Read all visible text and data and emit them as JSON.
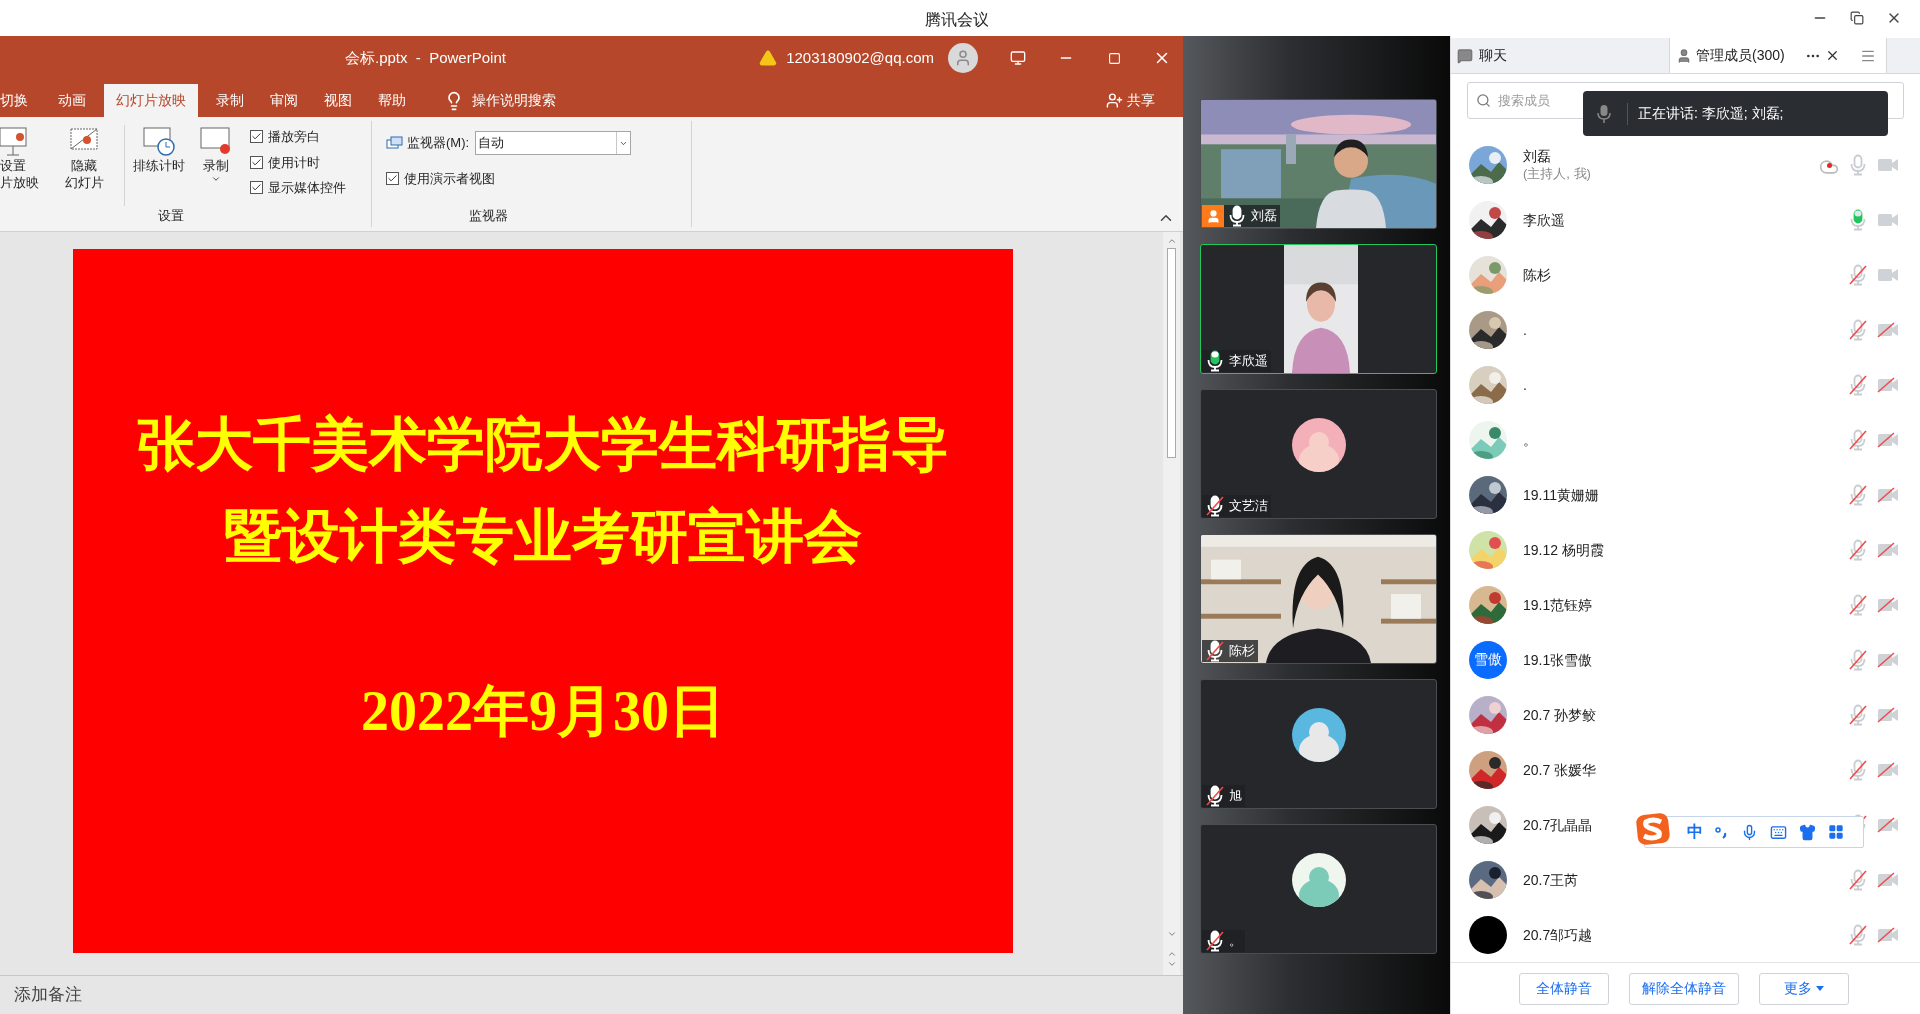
{
  "meeting": {
    "title": "腾讯会议"
  },
  "ppt": {
    "title": "会标.pptx  -  PowerPoint",
    "account": "1203180902@qq.com",
    "tabs": [
      {
        "label": "切换",
        "selected": false
      },
      {
        "label": "动画",
        "selected": false
      },
      {
        "label": "幻灯片放映",
        "selected": true
      },
      {
        "label": "录制",
        "selected": false
      },
      {
        "label": "审阅",
        "selected": false
      },
      {
        "label": "视图",
        "selected": false
      },
      {
        "label": "帮助",
        "selected": false
      }
    ],
    "search": "操作说明搜索",
    "share": "共享",
    "ribbon": {
      "commands": [
        {
          "kind": "setup",
          "lines": [
            "设置",
            "片放映"
          ]
        },
        {
          "kind": "hide",
          "lines": [
            "隐藏",
            "幻灯片"
          ]
        },
        {
          "kind": "rehearse",
          "lines": [
            "排练计时"
          ]
        },
        {
          "kind": "record",
          "lines": [
            "录制"
          ]
        }
      ],
      "options": [
        {
          "label": "播放旁白",
          "checked": true
        },
        {
          "label": "使用计时",
          "checked": true
        },
        {
          "label": "显示媒体控件",
          "checked": true
        }
      ],
      "monitor": {
        "label": "监视器(M):",
        "value": "自动"
      },
      "presenter_view": {
        "label": "使用演示者视图",
        "checked": true
      },
      "groups": [
        "设置",
        "监视器"
      ]
    },
    "slide": {
      "title_lines": [
        "张大千美术学院大学生科研指导",
        "暨设计类专业考研宣讲会"
      ],
      "date": "2022年9月30日"
    },
    "notes": "添加备注"
  },
  "videos": [
    {
      "name": "刘磊",
      "kind": "video",
      "muted": false,
      "speaking": false,
      "host": true,
      "active": false
    },
    {
      "name": "李欣遥",
      "kind": "video",
      "muted": false,
      "speaking": true,
      "host": false,
      "active": true
    },
    {
      "name": "文艺洁",
      "kind": "avatar",
      "muted": true,
      "speaking": false,
      "host": false,
      "active": false
    },
    {
      "name": "陈杉",
      "kind": "video",
      "muted": true,
      "speaking": false,
      "host": false,
      "active": false
    },
    {
      "name": "旭",
      "kind": "avatar",
      "muted": true,
      "speaking": false,
      "host": false,
      "active": false
    },
    {
      "name": "。",
      "kind": "avatar",
      "muted": true,
      "speaking": false,
      "host": false,
      "active": false
    }
  ],
  "panel": {
    "tabs": [
      {
        "label": "聊天",
        "selected": false
      },
      {
        "label": "管理成员(300)",
        "selected": true
      }
    ],
    "search_placeholder": "搜索成员",
    "speaking_toast": "正在讲话: 李欣遥; 刘磊;",
    "members": [
      {
        "name": "刘磊",
        "subtitle": "(主持人, 我)",
        "recording": true,
        "muted": false,
        "speaking": false,
        "camera_off": false
      },
      {
        "name": "李欣遥",
        "recording": false,
        "muted": false,
        "speaking": true,
        "camera_off": false
      },
      {
        "name": "陈杉",
        "recording": false,
        "muted": true,
        "speaking": false,
        "camera_off": false
      },
      {
        "name": ".",
        "recording": false,
        "muted": true,
        "speaking": false,
        "camera_off": true
      },
      {
        "name": ".",
        "recording": false,
        "muted": true,
        "speaking": false,
        "camera_off": true
      },
      {
        "name": "。",
        "recording": false,
        "muted": true,
        "speaking": false,
        "camera_off": true
      },
      {
        "name": "19.11黄姗姗",
        "recording": false,
        "muted": true,
        "speaking": false,
        "camera_off": true
      },
      {
        "name": "19.12 杨明霞",
        "recording": false,
        "muted": true,
        "speaking": false,
        "camera_off": true
      },
      {
        "name": "19.1范钰婷",
        "recording": false,
        "muted": true,
        "speaking": false,
        "camera_off": true
      },
      {
        "name": "19.1张雪傲",
        "avatar": {
          "kind": "initials",
          "text": "雪傲",
          "color": "#0a6cff"
        },
        "recording": false,
        "muted": true,
        "speaking": false,
        "camera_off": true
      },
      {
        "name": "20.7 孙梦鲛",
        "recording": false,
        "muted": true,
        "speaking": false,
        "camera_off": true
      },
      {
        "name": "20.7 张媛华",
        "recording": false,
        "muted": true,
        "speaking": false,
        "camera_off": true
      },
      {
        "name": "20.7孔晶晶",
        "recording": false,
        "muted": true,
        "speaking": false,
        "camera_off": true
      },
      {
        "name": "20.7王芮",
        "recording": false,
        "muted": true,
        "speaking": false,
        "camera_off": true
      },
      {
        "name": "20.7邹巧越",
        "avatar": {
          "kind": "plain",
          "color": "#000000"
        },
        "recording": false,
        "muted": true,
        "speaking": false,
        "camera_off": true
      }
    ],
    "buttons": [
      "全体静音",
      "解除全体静音",
      "更多"
    ]
  },
  "ime": {
    "label": "中"
  }
}
